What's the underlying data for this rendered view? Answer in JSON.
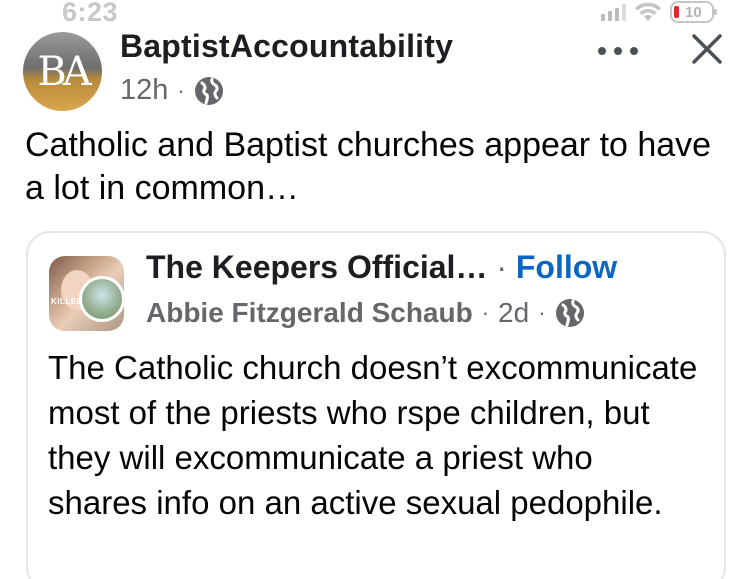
{
  "status_bar": {
    "time": "6:23",
    "battery": "10",
    "icons": [
      "signal-icon",
      "wifi-icon",
      "battery-icon"
    ]
  },
  "post": {
    "page_name": "BaptistAccountability",
    "avatar_letters": "BA",
    "time": "12h",
    "separator": "·",
    "audience_icon": "globe-icon",
    "menu_icon": "more-options-icon",
    "close_icon": "close-icon",
    "text": "Catholic and Baptist churches appear to have a lot in common…"
  },
  "shared_post": {
    "page_name": "The Keepers Official…",
    "separator": "·",
    "follow_label": "Follow",
    "author": "Abbie Fitzgerald Schaub",
    "time": "2d",
    "audience_icon": "globe-icon",
    "avatar_text": "KILLED",
    "text": "The Catholic church doesn’t excommunicate most of the priests who rspe children, but they will excommunicate a priest who shares info on an active sexual pedophile."
  },
  "colors": {
    "link_blue": "#0a66c2",
    "secondary_text": "#65676b",
    "battery_low": "#e5282a"
  }
}
